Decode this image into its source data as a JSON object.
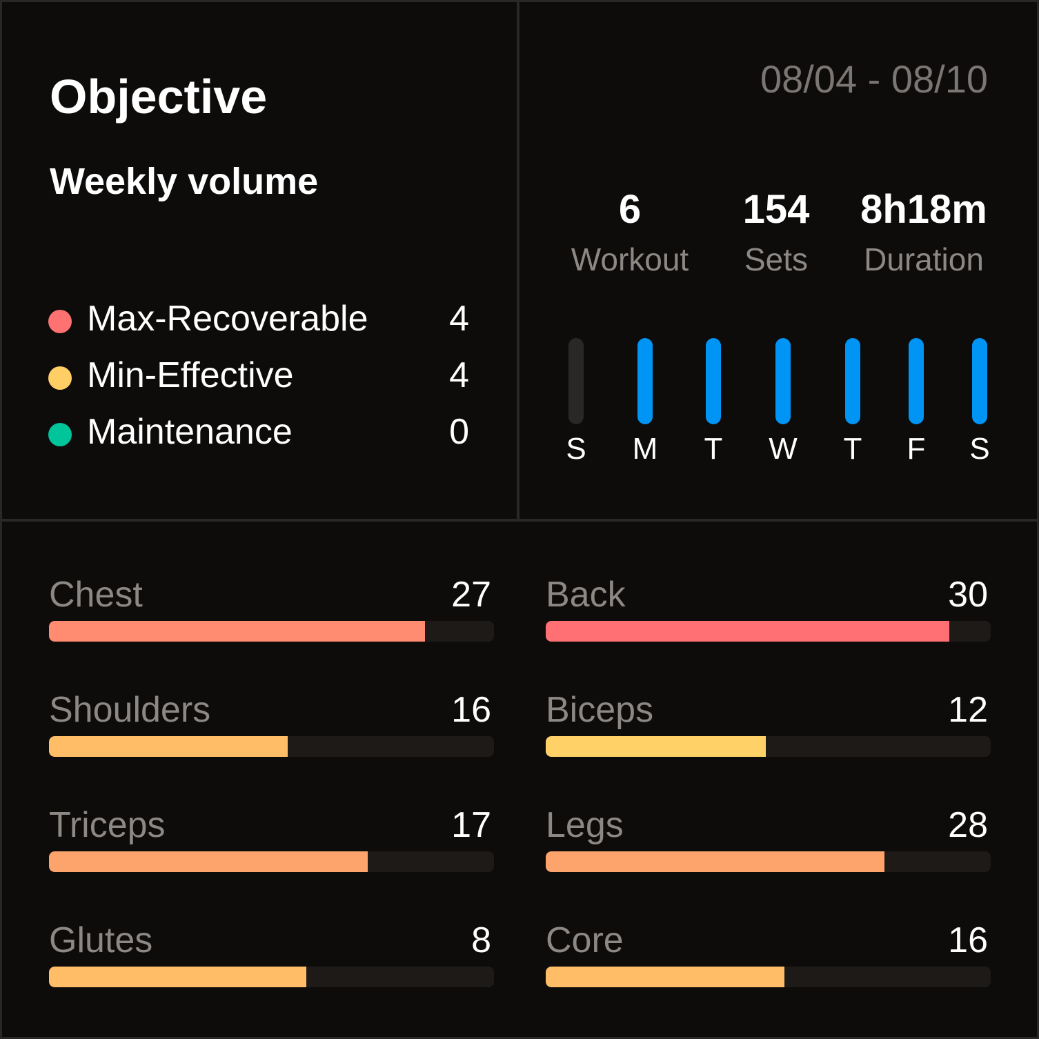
{
  "objective": {
    "title": "Objective",
    "subtitle": "Weekly volume",
    "legend": [
      {
        "label": "Max-Recoverable",
        "value": "4",
        "color": "#ff7272"
      },
      {
        "label": "Min-Effective",
        "value": "4",
        "color": "#ffcf66"
      },
      {
        "label": "Maintenance",
        "value": "0",
        "color": "#00c49a"
      }
    ]
  },
  "week": {
    "date_range": "08/04 - 08/10",
    "stats": [
      {
        "value": "6",
        "label": "Workout"
      },
      {
        "value": "154",
        "label": "Sets"
      },
      {
        "value": "8h18m",
        "label": "Duration"
      }
    ],
    "days": [
      {
        "label": "S",
        "active": false
      },
      {
        "label": "M",
        "active": true
      },
      {
        "label": "T",
        "active": true
      },
      {
        "label": "W",
        "active": true
      },
      {
        "label": "T",
        "active": true
      },
      {
        "label": "F",
        "active": true
      },
      {
        "label": "S",
        "active": true
      }
    ],
    "active_color": "#0094f5",
    "inactive_color": "#2a2827"
  },
  "muscles": [
    {
      "name": "Chest",
      "value": "27",
      "progress": 0.845,
      "color": "#ff8b70"
    },
    {
      "name": "Back",
      "value": "30",
      "progress": 0.907,
      "color": "#ff7074"
    },
    {
      "name": "Shoulders",
      "value": "16",
      "progress": 0.536,
      "color": "#ffbd68"
    },
    {
      "name": "Biceps",
      "value": "12",
      "progress": 0.494,
      "color": "#ffd166"
    },
    {
      "name": "Triceps",
      "value": "17",
      "progress": 0.716,
      "color": "#fca46c"
    },
    {
      "name": "Legs",
      "value": "28",
      "progress": 0.762,
      "color": "#fca46c"
    },
    {
      "name": "Glutes",
      "value": "8",
      "progress": 0.578,
      "color": "#ffbd68"
    },
    {
      "name": "Core",
      "value": "16",
      "progress": 0.536,
      "color": "#ffbd68"
    }
  ]
}
